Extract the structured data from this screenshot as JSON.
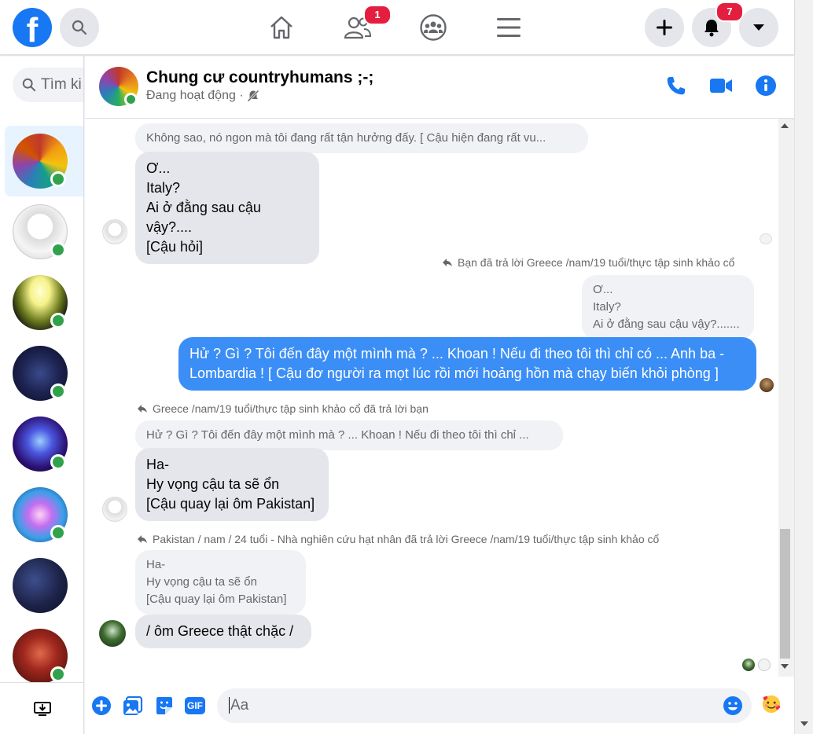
{
  "nav": {
    "notifications_badge": "7",
    "friends_badge": "1"
  },
  "search": {
    "placeholder": "Tìm ki"
  },
  "chat": {
    "title": "Chung cư countryhumans ;-;",
    "status": "Đang hoạt động ·"
  },
  "messages": {
    "quote1": "Không sao, nó ngon mà tôi đang rất tận hưởng đấy. [ Cậu hiện đang rất vu...",
    "msg1": "Ơ...\nItaly?\nAi ở đằng sau cậu vậy?....\n[Cậu hỏi]",
    "reply_label_me": "Bạn đã trả lời Greece /nam/19 tuổi/thực tập sinh khảo cổ",
    "quote2": "Ơ...\nItaly?\nAi ở đằng sau cậu vậy?.......",
    "msg_out": "Hử ? Gì ? Tôi đến đây một mình mà ? ... Khoan ! Nếu đi theo tôi thì chỉ có ... Anh ba - Lombardia ! [ Cậu đơ người ra mọt lúc rồi mới hoảng hồn mà chạy biến khỏi phòng ]",
    "reply_label_greece": "Greece /nam/19 tuổi/thực tập sinh khảo cổ đã trả lời bạn",
    "quote3": "Hử ? Gì ? Tôi đến đây một mình mà ? ... Khoan ! Nếu đi theo tôi thì chỉ ...",
    "msg2": "Ha-\nHy vọng cậu ta sẽ ổn\n[Cậu quay lại ôm Pakistan]",
    "reply_label_pakistan": "Pakistan / nam / 24 tuổi - Nhà nghiên cứu hạt nhân đã trả lời Greece /nam/19 tuổi/thực tập sinh khảo cổ",
    "quote4": "Ha-\nHy vọng cậu ta sẽ ổn\n[Cậu quay lại ôm Pakistan]",
    "msg3": "/ ôm Greece thật chặc /"
  },
  "composer": {
    "placeholder": "Aa",
    "gif_label": "GIF"
  },
  "colors": {
    "accent": "#1877f2",
    "outgoing_bubble": "#3b8ef5",
    "online": "#31a24c",
    "badge": "#e41e3f"
  }
}
